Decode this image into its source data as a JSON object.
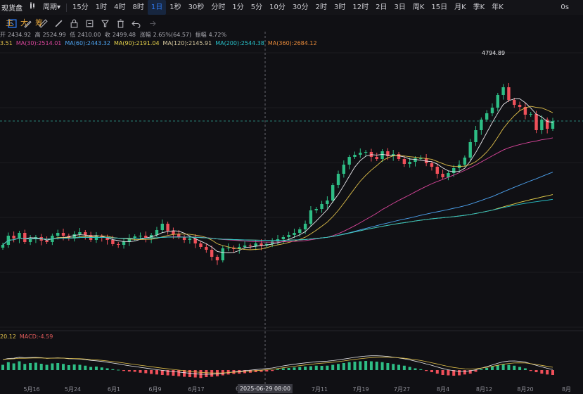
{
  "toolbar": {
    "title": "现货盘",
    "chart_type_icon": "candle-type-icon",
    "period_label": "周期",
    "intervals": [
      "15分",
      "1时",
      "4时",
      "8时",
      "1日",
      "1秒",
      "30秒",
      "分时",
      "1分",
      "5分",
      "10分",
      "30分",
      "2时",
      "3时",
      "12时",
      "2日",
      "3日",
      "周K",
      "15日",
      "月K",
      "季K",
      "年K"
    ],
    "active_interval": "1日",
    "countdown": "0s"
  },
  "drawing_tools": {
    "icons": [
      "expand-icon",
      "pencil-icon",
      "ruler-icon",
      "brush-icon",
      "lock-icon",
      "hide-icon",
      "magnet-icon",
      "delete-icon",
      "undo-icon",
      "redo-icon"
    ],
    "chips": [
      "主",
      "大",
      "筹"
    ]
  },
  "ohlc": {
    "open_label": "开",
    "open": "2434.92",
    "high_label": "高",
    "high": "2524.99",
    "low_label": "低",
    "low": "2410.00",
    "close_label": "收",
    "close": "2499.48",
    "change_label": "涨幅",
    "change": "2.65%(64.57)",
    "amplitude_label": "振幅",
    "amplitude": "4.72%"
  },
  "ma_legend": [
    {
      "text": "3.51",
      "color": "#e0c04a"
    },
    {
      "text": "MA(30):2514.01",
      "color": "#d9459b"
    },
    {
      "text": "MA(60):2443.32",
      "color": "#4da3f0"
    },
    {
      "text": "MA(90):2191.04",
      "color": "#e8d44c"
    },
    {
      "text": "MA(120):2145.91",
      "color": "#d7c9a0"
    },
    {
      "text": "MA(200):2544.38",
      "color": "#27c0c8"
    },
    {
      "text": "MA(360):2684.12",
      "color": "#e88a3a"
    }
  ],
  "macd_legend": [
    {
      "text": "20.12",
      "color": "#e0c04a"
    },
    {
      "text": "MACD:-4.59",
      "color": "#e05a5a"
    }
  ],
  "x_ticks": [
    {
      "label": "5月16"
    },
    {
      "label": "5月24"
    },
    {
      "label": "6月1"
    },
    {
      "label": "6月9"
    },
    {
      "label": "6月17"
    },
    {
      "label": "6"
    },
    {
      "label": "7月3"
    },
    {
      "label": "7月11"
    },
    {
      "label": "7月19"
    },
    {
      "label": "7月27"
    },
    {
      "label": "8月4"
    },
    {
      "label": "8月12"
    },
    {
      "label": "8月20"
    },
    {
      "label": "8月"
    }
  ],
  "crosshair": {
    "label": "2025-06-29 08:00"
  },
  "peak": {
    "label": "4794.89"
  },
  "chart_data": {
    "type": "candlestick",
    "title": "",
    "price_range": [
      1300,
      5200
    ],
    "closes": [
      2470,
      2600,
      2560,
      2640,
      2510,
      2550,
      2580,
      2530,
      2510,
      2600,
      2640,
      2600,
      2560,
      2620,
      2650,
      2610,
      2540,
      2590,
      2570,
      2540,
      2480,
      2470,
      2520,
      2560,
      2590,
      2600,
      2560,
      2610,
      2680,
      2770,
      2670,
      2620,
      2580,
      2540,
      2560,
      2490,
      2440,
      2400,
      2300,
      2250,
      2420,
      2430,
      2410,
      2440,
      2460,
      2450,
      2490,
      2460,
      2480,
      2520,
      2550,
      2580,
      2610,
      2640,
      2690,
      2770,
      2960,
      2980,
      3050,
      3100,
      3320,
      3480,
      3610,
      3720,
      3750,
      3780,
      3790,
      3720,
      3690,
      3800,
      3730,
      3760,
      3690,
      3620,
      3650,
      3700,
      3700,
      3630,
      3580,
      3480,
      3430,
      3490,
      3560,
      3610,
      3710,
      3930,
      4100,
      4250,
      4340,
      4420,
      4600,
      4710,
      4530,
      4460,
      4430,
      4320,
      4330,
      4100,
      4250,
      4120,
      4230
    ],
    "macd_hist": [
      30,
      45,
      38,
      50,
      35,
      40,
      42,
      36,
      30,
      38,
      40,
      35,
      28,
      32,
      30,
      25,
      18,
      20,
      15,
      10,
      5,
      2,
      -5,
      -8,
      -10,
      -15,
      -18,
      -22,
      -25,
      -28,
      -30,
      -32,
      -35,
      -38,
      -40,
      -42,
      -45,
      -40,
      -38,
      -35,
      -30,
      -25,
      -22,
      -20,
      -18,
      -15,
      -12,
      -10,
      -8,
      -5,
      5,
      10,
      12,
      15,
      18,
      20,
      22,
      25,
      24,
      25,
      30,
      35,
      40,
      45,
      48,
      50,
      52,
      50,
      48,
      45,
      40,
      35,
      30,
      25,
      18,
      10,
      5,
      -5,
      -12,
      -20,
      -28,
      -30,
      -32,
      -30,
      -25,
      -20,
      -10,
      5,
      12,
      20,
      28,
      32,
      30,
      25,
      18,
      10,
      -5,
      -12,
      -20,
      -25,
      -28
    ]
  }
}
